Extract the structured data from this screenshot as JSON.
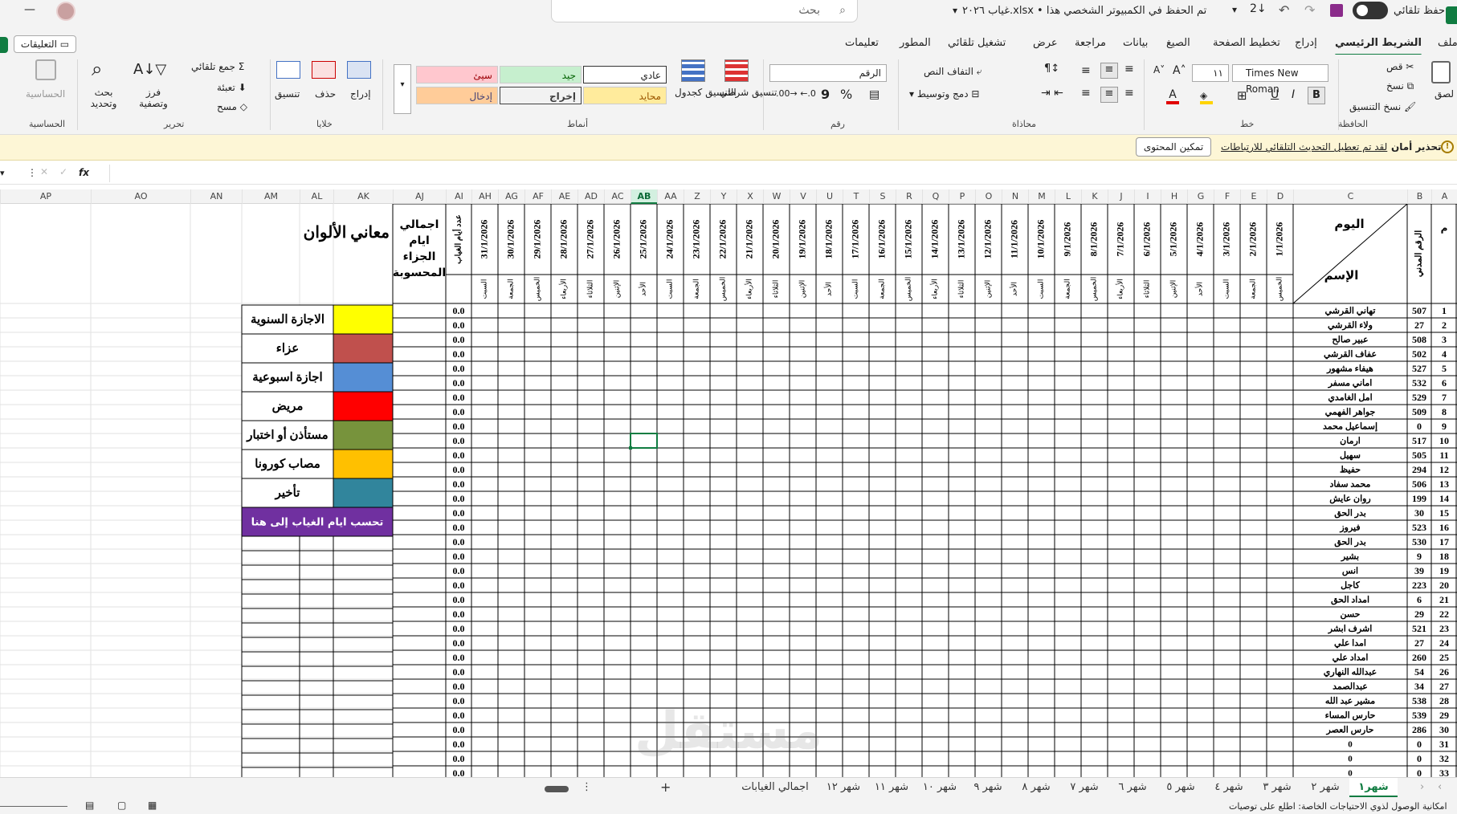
{
  "titlebar": {
    "autosave": "حفظ تلقائي",
    "filename": "غياب ٢٠٢٦.xlsx • تم الحفظ في الكمبيوتر الشخصي هذا",
    "search": "بحث",
    "quick_sa": "Σ"
  },
  "menu_tabs": [
    "ملف",
    "الشريط الرئيسي",
    "إدراج",
    "تخطيط الصفحة",
    "الصيغ",
    "بيانات",
    "مراجعة",
    "عرض",
    "تشغيل تلقائي",
    "المطور",
    "تعليمات"
  ],
  "comments_btn": "التعليقات",
  "ribbon": {
    "clipboard": {
      "paste": "لصق",
      "cut": "قص",
      "copy": "نسخ",
      "format_painter": "نسخ التنسيق",
      "group": "الحافظة"
    },
    "font": {
      "name": "Times New Roman",
      "size": "١١",
      "bold": "B",
      "italic": "I",
      "underline": "U",
      "group": "خط"
    },
    "alignment": {
      "wrap": "التفاف النص",
      "merge": "دمج وتوسيط",
      "group": "محاذاة"
    },
    "number": {
      "format": "الرقم",
      "percent": "%",
      "comma": "9",
      "group": "رقم"
    },
    "styles": {
      "cond": "تنسيق شرطي",
      "astable": "التنسيق كجدول",
      "normal": "عادي",
      "bad": "سيئ",
      "good": "جيد",
      "neutral": "محايد",
      "output": "إخراج",
      "input": "إدخال",
      "group": "أنماط"
    },
    "cells": {
      "insert": "إدراج",
      "delete": "حذف",
      "format": "تنسيق",
      "group": "خلايا"
    },
    "editing": {
      "autosum": "جمع تلقائي",
      "fill": "تعبئة",
      "clear": "مسح",
      "sort": "فرز وتصفية",
      "find": "بحث وتحديد",
      "group": "تحرير"
    },
    "sensitivity": {
      "label": "الحساسية",
      "group": "الحساسية"
    }
  },
  "security_bar": {
    "title": "تحذير أمان",
    "message": "لقد تم تعطيل التحديث التلقائي للارتباطات",
    "button": "تمكين المحتوى"
  },
  "formula_bar": {
    "fx": "fx",
    "name_box": ""
  },
  "column_headers": [
    "A",
    "B",
    "C",
    "D",
    "E",
    "F",
    "G",
    "H",
    "I",
    "J",
    "K",
    "L",
    "M",
    "N",
    "O",
    "P",
    "Q",
    "R",
    "S",
    "T",
    "U",
    "V",
    "W",
    "X",
    "Y",
    "Z",
    "AA",
    "AB",
    "AC",
    "AD",
    "AE",
    "AF",
    "AG",
    "AH",
    "AI",
    "AJ",
    "AK",
    "AL",
    "AM",
    "AN",
    "AO",
    "AP"
  ],
  "table_header": {
    "seq": "م",
    "civil": "الرقم المدني",
    "day": "اليوم",
    "name": "الإسم",
    "absence_days": "عدد أيام الغياب",
    "total": "اجمالي ايام الجزاء المحسوبة"
  },
  "dates": [
    "1/1/2026",
    "2/1/2026",
    "3/1/2026",
    "4/1/2026",
    "5/1/2026",
    "6/1/2026",
    "7/1/2026",
    "8/1/2026",
    "9/1/2026",
    "10/1/2026",
    "11/1/2026",
    "12/1/2026",
    "13/1/2026",
    "14/1/2026",
    "15/1/2026",
    "16/1/2026",
    "17/1/2026",
    "18/1/2026",
    "19/1/2026",
    "20/1/2026",
    "21/1/2026",
    "22/1/2026",
    "23/1/2026",
    "24/1/2026",
    "25/1/2026",
    "26/1/2026",
    "27/1/2026",
    "28/1/2026",
    "29/1/2026",
    "30/1/2026",
    "31/1/2026"
  ],
  "weekdays": [
    "الخميس",
    "الجمعة",
    "السبت",
    "الأحد",
    "الإثنين",
    "الثلاثاء",
    "الأربعاء",
    "الخميس",
    "الجمعة",
    "السبت",
    "الأحد",
    "الإثنين",
    "الثلاثاء",
    "الأربعاء",
    "الخميس",
    "الجمعة",
    "السبت",
    "الأحد",
    "الإثنين",
    "الثلاثاء",
    "الأربعاء",
    "الخميس",
    "الجمعة",
    "السبت",
    "الأحد",
    "الإثنين",
    "الثلاثاء",
    "الأربعاء",
    "الخميس",
    "الجمعة",
    "السبت"
  ],
  "rows": [
    {
      "n": "1",
      "id": "507",
      "name": "تهاني القرشي",
      "abs": "0.0"
    },
    {
      "n": "2",
      "id": "27",
      "name": "ولاء القرشي",
      "abs": "0.0"
    },
    {
      "n": "3",
      "id": "508",
      "name": "عبير صالح",
      "abs": "0.0"
    },
    {
      "n": "4",
      "id": "502",
      "name": "عفاف القرشي",
      "abs": "0.0"
    },
    {
      "n": "5",
      "id": "527",
      "name": "هيفاء مشهور",
      "abs": "0.0"
    },
    {
      "n": "6",
      "id": "532",
      "name": "اماني مسفر",
      "abs": "0.0"
    },
    {
      "n": "7",
      "id": "529",
      "name": "امل الغامدي",
      "abs": "0.0"
    },
    {
      "n": "8",
      "id": "509",
      "name": "جواهر الفهمي",
      "abs": "0.0"
    },
    {
      "n": "9",
      "id": "0",
      "name": "إسماعيل محمد",
      "abs": "0.0"
    },
    {
      "n": "10",
      "id": "517",
      "name": "ارمان",
      "abs": "0.0"
    },
    {
      "n": "11",
      "id": "505",
      "name": "سهيل",
      "abs": "0.0"
    },
    {
      "n": "12",
      "id": "294",
      "name": "حفيظ",
      "abs": "0.0"
    },
    {
      "n": "13",
      "id": "506",
      "name": "محمد سفاد",
      "abs": "0.0"
    },
    {
      "n": "14",
      "id": "199",
      "name": "روان عايش",
      "abs": "0.0"
    },
    {
      "n": "15",
      "id": "30",
      "name": "بدر الحق",
      "abs": "0.0"
    },
    {
      "n": "16",
      "id": "523",
      "name": "فيروز",
      "abs": "0.0"
    },
    {
      "n": "17",
      "id": "530",
      "name": "بدر الحق",
      "abs": "0.0"
    },
    {
      "n": "18",
      "id": "9",
      "name": "بشير",
      "abs": "0.0"
    },
    {
      "n": "19",
      "id": "39",
      "name": "انس",
      "abs": "0.0"
    },
    {
      "n": "20",
      "id": "223",
      "name": "كاجل",
      "abs": "0.0"
    },
    {
      "n": "21",
      "id": "6",
      "name": "امداد الحق",
      "abs": "0.0"
    },
    {
      "n": "22",
      "id": "29",
      "name": "حسن",
      "abs": "0.0"
    },
    {
      "n": "23",
      "id": "521",
      "name": "اشرف ابشر",
      "abs": "0.0"
    },
    {
      "n": "24",
      "id": "27",
      "name": "امدا علي",
      "abs": "0.0"
    },
    {
      "n": "25",
      "id": "260",
      "name": "امداد علي",
      "abs": "0.0"
    },
    {
      "n": "26",
      "id": "54",
      "name": "عبدالله النهاري",
      "abs": "0.0"
    },
    {
      "n": "27",
      "id": "34",
      "name": "عبدالصمد",
      "abs": "0.0"
    },
    {
      "n": "28",
      "id": "538",
      "name": "مشير عبد الله",
      "abs": "0.0"
    },
    {
      "n": "29",
      "id": "539",
      "name": "حارس المساء",
      "abs": "0.0"
    },
    {
      "n": "30",
      "id": "286",
      "name": "حارس العصر",
      "abs": "0.0"
    },
    {
      "n": "31",
      "id": "0",
      "name": "0",
      "abs": "0.0"
    },
    {
      "n": "32",
      "id": "0",
      "name": "0",
      "abs": "0.0"
    },
    {
      "n": "33",
      "id": "0",
      "name": "0",
      "abs": "0.0"
    }
  ],
  "legend": {
    "title": "معاني الألوان",
    "items": [
      {
        "label": "الاجازة السنوية",
        "color": "#ffff00"
      },
      {
        "label": "عزاء",
        "color": "#c0504d"
      },
      {
        "label": "اجازة اسبوعية",
        "color": "#558ed5"
      },
      {
        "label": "مريض",
        "color": "#ff0000"
      },
      {
        "label": "مستأذن أو اختبار",
        "color": "#77933c"
      },
      {
        "label": "مصاب كورونا",
        "color": "#ffc000"
      },
      {
        "label": "تأخير",
        "color": "#31859c"
      }
    ],
    "note": "تحسب ايام الغياب إلى هنا",
    "note_color": "#7030a0"
  },
  "sheet_tabs": [
    "شهر١",
    "شهر ٢",
    "شهر ٣",
    "شهر ٤",
    "شهر ٥",
    "شهر ٦",
    "شهر ٧",
    "شهر ٨",
    "شهر ٩",
    "شهر ١٠",
    "شهر ١١",
    "شهر ١٢",
    "اجمالي الغيابات"
  ],
  "status": {
    "text": "امكانية الوصول لذوي الاحتياجات الخاصة: اطلع على توصيات"
  },
  "watermark": "مستقل"
}
